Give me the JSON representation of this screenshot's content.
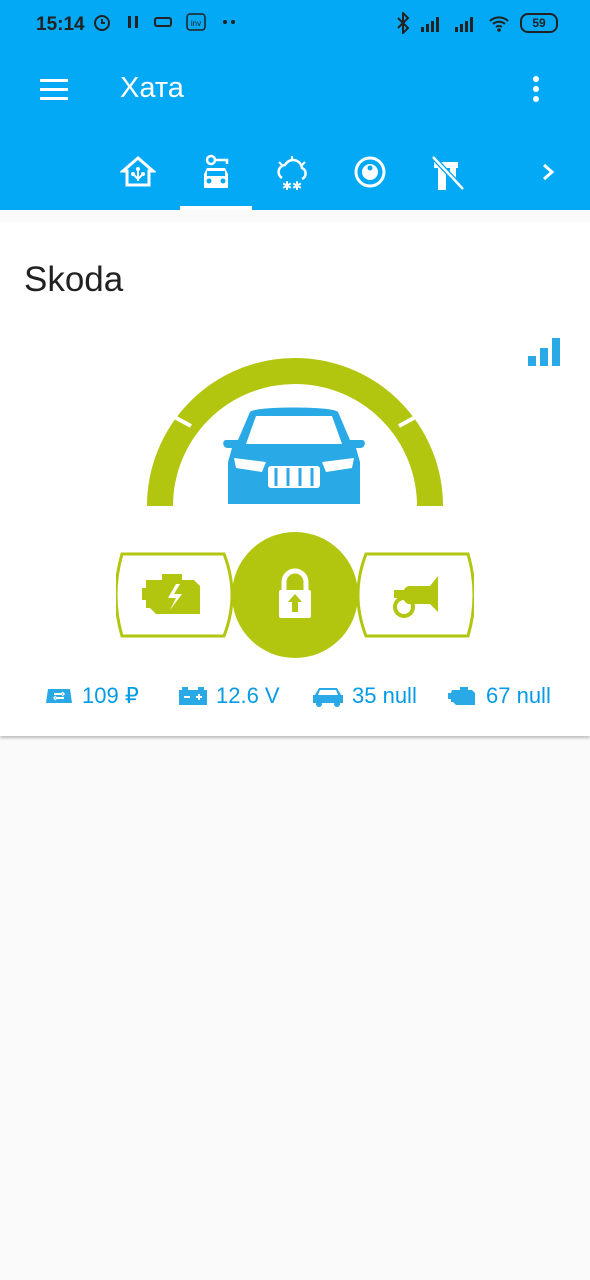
{
  "status_bar": {
    "time": "15:14",
    "battery": "59",
    "left_icons": [
      "alarm-icon",
      "pause-icon",
      "notification-icon",
      "inv-icon",
      "dots-icon"
    ],
    "right_icons": [
      "bluetooth-icon",
      "signal-icon",
      "signal-icon",
      "wifi-icon",
      "battery-icon"
    ]
  },
  "toolbar": {
    "title": "Хата",
    "menu_icon": "menu-icon",
    "more_icon": "more-vert-icon"
  },
  "tabs": [
    {
      "icon": "home-automation-icon",
      "selected": false
    },
    {
      "icon": "car-key-icon",
      "selected": true
    },
    {
      "icon": "weather-snowy-icon",
      "selected": false
    },
    {
      "icon": "robot-vacuum-icon",
      "selected": false
    },
    {
      "icon": "water-pump-off-icon",
      "selected": false
    },
    {
      "icon": "chevron-right-icon",
      "selected": false
    }
  ],
  "card": {
    "title": "Skoda",
    "signal_icon": "signal-cellular-icon",
    "controls": {
      "left": "engine-start-icon",
      "center": "lock-icon",
      "right": "horn-icon"
    },
    "stats": [
      {
        "icon": "balance-icon",
        "value": "109 ₽"
      },
      {
        "icon": "car-battery-icon",
        "value": "12.6 V"
      },
      {
        "icon": "car-temp-icon",
        "value": "35 null"
      },
      {
        "icon": "engine-temp-icon",
        "value": "67 null"
      }
    ]
  },
  "colors": {
    "header": "#03a9f4",
    "accent_green": "#b2c50f",
    "car_blue": "#29a9e6",
    "stat_text": "#039be5",
    "background": "#fafafa",
    "card": "#ffffff"
  }
}
